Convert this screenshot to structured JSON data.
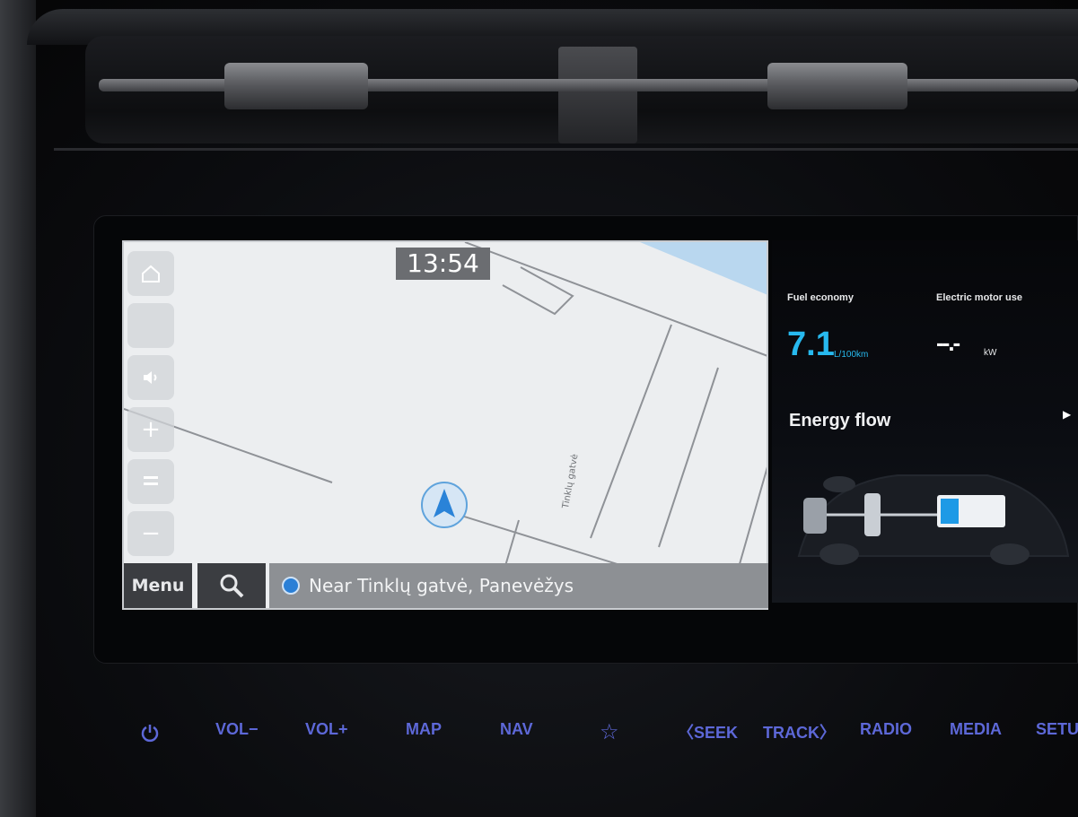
{
  "map": {
    "clock": "13:54",
    "menu_label": "Menu",
    "location_text": "Near Tinklų gatvė, Panevėžys",
    "street_label": "Tinklų gatvė",
    "controls": [
      "home-icon",
      "compass-icon",
      "sound-icon",
      "zoom-in-icon",
      "view-mode-icon",
      "zoom-out-icon"
    ]
  },
  "panel": {
    "fuel_label": "Fuel economy",
    "fuel_value": "7.1",
    "fuel_unit": "L/100km",
    "motor_label": "Electric motor use",
    "motor_value": "--.-",
    "motor_unit": "kW",
    "energy_title": "Energy flow",
    "battery_level": 0.3
  },
  "hardware_buttons": {
    "power": "power-icon",
    "vol_down": "VOL−",
    "vol_up": "VOL+",
    "map": "MAP",
    "nav": "NAV",
    "favorite": "star-icon",
    "seek": "〈SEEK",
    "track": "TRACK〉",
    "radio": "RADIO",
    "media": "MEDIA",
    "setup": "SETU"
  },
  "colors": {
    "accent_blue": "#27b9ef",
    "button_blue": "#5d68d8",
    "map_bg": "#eceef0"
  }
}
